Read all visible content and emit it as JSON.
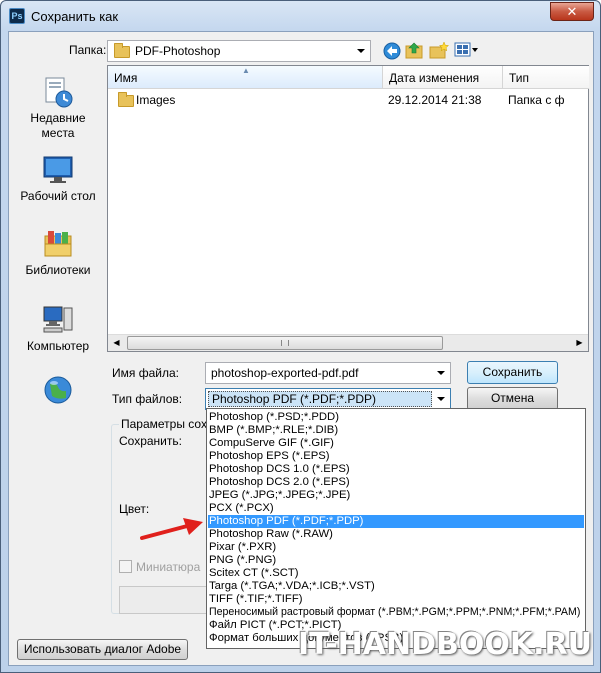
{
  "window": {
    "title": "Сохранить как",
    "app_icon": "Ps",
    "close_glyph": "✕"
  },
  "folder_bar": {
    "label": "Папка:",
    "current_folder": "PDF-Photoshop",
    "icons": [
      "back-icon",
      "up-folder-icon",
      "new-folder-icon",
      "view-menu-icon"
    ]
  },
  "places": [
    {
      "label": "Недавние места",
      "icon": "recent-places-icon"
    },
    {
      "label": "Рабочий стол",
      "icon": "desktop-icon"
    },
    {
      "label": "Библиотеки",
      "icon": "libraries-icon"
    },
    {
      "label": "Компьютер",
      "icon": "computer-icon"
    },
    {
      "label": "",
      "icon": "network-icon"
    }
  ],
  "file_list": {
    "columns": [
      "Имя",
      "Дата изменения",
      "Тип"
    ],
    "rows": [
      {
        "name": "Images",
        "date": "29.12.2014 21:38",
        "type": "Папка с ф"
      }
    ]
  },
  "form": {
    "filename_label": "Имя файла:",
    "filename_value": "photoshop-exported-pdf.pdf",
    "filetype_label": "Тип файлов:",
    "filetype_value": "Photoshop PDF (*.PDF;*.PDP)",
    "save_button": "Сохранить",
    "cancel_button": "Отмена"
  },
  "save_options": {
    "group_label": "Параметры сох",
    "save_label": "Сохранить:",
    "color_label": "Цвет:",
    "thumbnail_label": "Миниатюра"
  },
  "filetype_options": [
    "Photoshop (*.PSD;*.PDD)",
    "BMP (*.BMP;*.RLE;*.DIB)",
    "CompuServe GIF (*.GIF)",
    "Photoshop EPS (*.EPS)",
    "Photoshop DCS 1.0 (*.EPS)",
    "Photoshop DCS 2.0 (*.EPS)",
    "JPEG (*.JPG;*.JPEG;*.JPE)",
    "PCX (*.PCX)",
    "Photoshop PDF (*.PDF;*.PDP)",
    "Photoshop Raw (*.RAW)",
    "Pixar (*.PXR)",
    "PNG (*.PNG)",
    "Scitex CT (*.SCT)",
    "Targa (*.TGA;*.VDA;*.ICB;*.VST)",
    "TIFF (*.TIF;*.TIFF)",
    "Переносимый растровый формат (*.PBM;*.PGM;*.PPM;*.PNM;*.PFM;*.PAM)",
    "Файл PICT (*.PCT;*.PICT)",
    "Формат больших документов (*.PSB)"
  ],
  "selected_option_index": 8,
  "adobe_dialog_button": "Использовать диалог Adobe",
  "watermark": "IT-HANDBOOK.RU",
  "colors": {
    "selection": "#3399ff",
    "arrow": "#e0201c"
  }
}
